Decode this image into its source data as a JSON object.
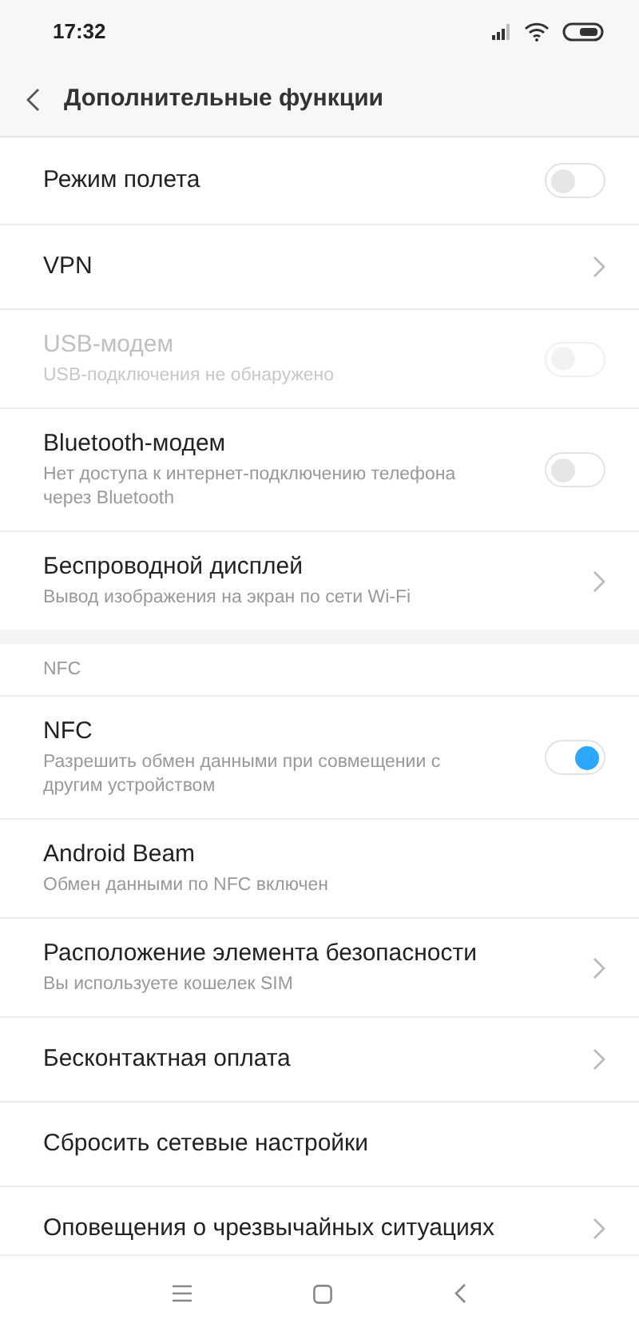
{
  "status_bar": {
    "time": "17:32"
  },
  "header": {
    "title": "Дополнительные функции"
  },
  "sections": [
    {
      "items": [
        {
          "kind": "toggle",
          "title": "Режим полета",
          "on": false,
          "disabled": false
        },
        {
          "kind": "link",
          "title": "VPN",
          "disabled": false
        },
        {
          "kind": "toggle",
          "title": "USB-модем",
          "subtitle": "USB-подключения не обнаружено",
          "on": false,
          "disabled": true
        },
        {
          "kind": "toggle",
          "title": "Bluetooth-модем",
          "subtitle": "Нет доступа к интернет-подключению телефона через Bluetooth",
          "on": false,
          "disabled": false
        },
        {
          "kind": "link",
          "title": "Беспроводной дисплей",
          "subtitle": "Вывод изображения на экран по сети Wi-Fi",
          "disabled": false
        }
      ]
    },
    {
      "heading": "NFC",
      "items": [
        {
          "kind": "toggle",
          "title": "NFC",
          "subtitle": "Разрешить обмен данными при совмещении с другим устройством",
          "on": true,
          "disabled": false
        },
        {
          "kind": "plain",
          "title": "Android Beam",
          "subtitle": "Обмен данными по NFC включен",
          "disabled": false
        },
        {
          "kind": "link",
          "title": "Расположение элемента безопасности",
          "subtitle": "Вы используете кошелек SIM",
          "disabled": false
        },
        {
          "kind": "link",
          "title": "Бесконтактная оплата",
          "disabled": false
        },
        {
          "kind": "plain",
          "title": "Сбросить сетевые настройки",
          "disabled": false
        },
        {
          "kind": "link",
          "title": "Оповещения о чрезвычайных ситуациях",
          "disabled": false
        }
      ]
    }
  ]
}
